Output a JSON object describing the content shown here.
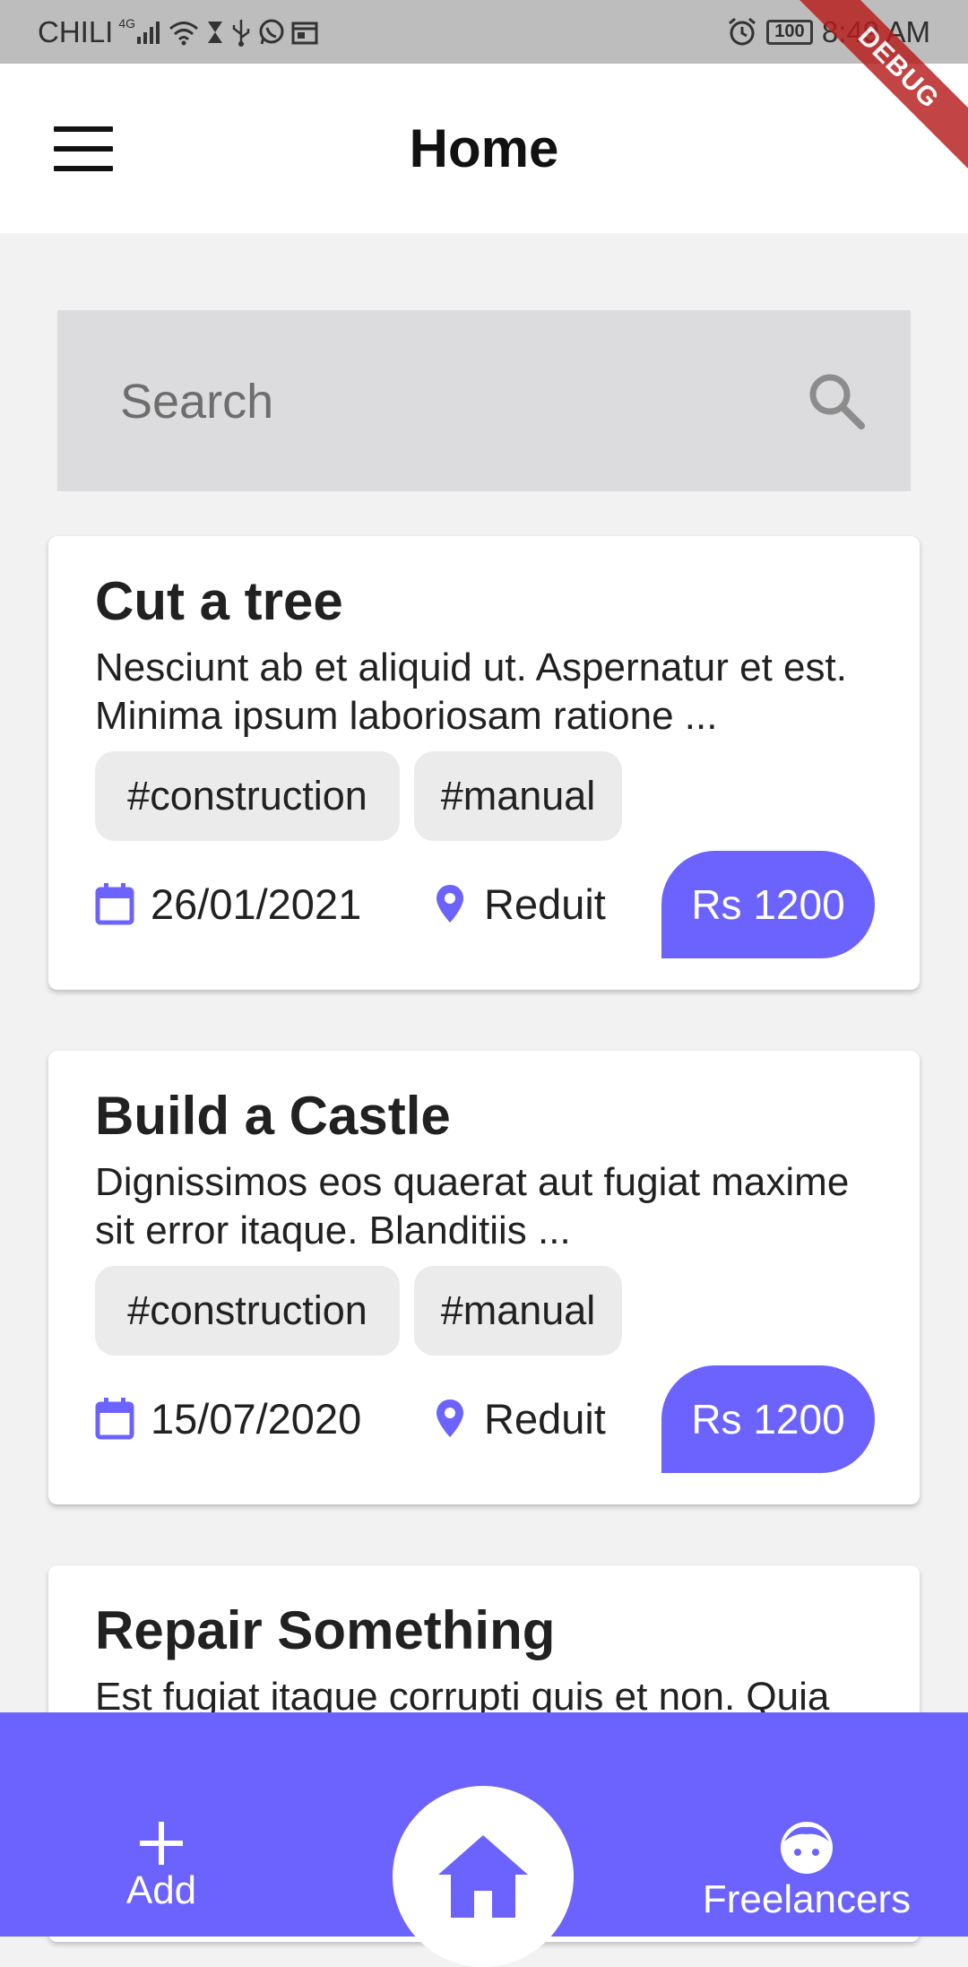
{
  "status_bar": {
    "carrier": "CHILI",
    "network": "4G",
    "battery": "100",
    "time": "8:49 AM"
  },
  "debug_banner": "DEBUG",
  "app_bar": {
    "title": "Home",
    "menu_icon": "menu-icon"
  },
  "search": {
    "placeholder": "Search",
    "icon": "search-icon"
  },
  "accent_color": "#6c63ff",
  "jobs": [
    {
      "title": "Cut a tree",
      "description": "Nesciunt ab et aliquid ut. Aspernatur et est. Minima ipsum laboriosam ratione ...",
      "tags": [
        "#construction",
        "#manual"
      ],
      "date": "26/01/2021",
      "location": "Reduit",
      "price": "Rs 1200"
    },
    {
      "title": "Build a Castle",
      "description": "Dignissimos eos quaerat aut fugiat maxime sit error itaque. Blanditiis ...",
      "tags": [
        "#construction",
        "#manual"
      ],
      "date": "15/07/2020",
      "location": "Reduit",
      "price": "Rs 1200"
    },
    {
      "title": "Repair Something",
      "description": "Est fugiat itaque corrupti quis et non. Quia labore similique ut edit facilis et ..."
    }
  ],
  "bottom_nav": {
    "add_label": "Add",
    "home_icon": "home-icon",
    "freelancers_label": "Freelancers"
  }
}
